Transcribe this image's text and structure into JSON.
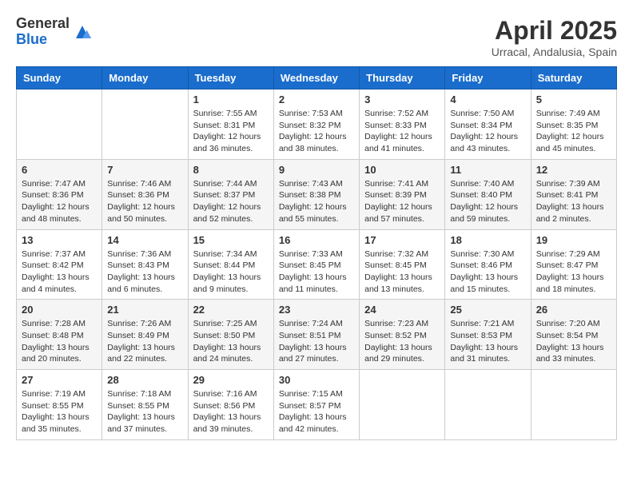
{
  "header": {
    "logo_general": "General",
    "logo_blue": "Blue",
    "month_title": "April 2025",
    "location": "Urracal, Andalusia, Spain"
  },
  "weekdays": [
    "Sunday",
    "Monday",
    "Tuesday",
    "Wednesday",
    "Thursday",
    "Friday",
    "Saturday"
  ],
  "weeks": [
    [
      {
        "day": "",
        "info": ""
      },
      {
        "day": "",
        "info": ""
      },
      {
        "day": "1",
        "info": "Sunrise: 7:55 AM\nSunset: 8:31 PM\nDaylight: 12 hours and 36 minutes."
      },
      {
        "day": "2",
        "info": "Sunrise: 7:53 AM\nSunset: 8:32 PM\nDaylight: 12 hours and 38 minutes."
      },
      {
        "day": "3",
        "info": "Sunrise: 7:52 AM\nSunset: 8:33 PM\nDaylight: 12 hours and 41 minutes."
      },
      {
        "day": "4",
        "info": "Sunrise: 7:50 AM\nSunset: 8:34 PM\nDaylight: 12 hours and 43 minutes."
      },
      {
        "day": "5",
        "info": "Sunrise: 7:49 AM\nSunset: 8:35 PM\nDaylight: 12 hours and 45 minutes."
      }
    ],
    [
      {
        "day": "6",
        "info": "Sunrise: 7:47 AM\nSunset: 8:36 PM\nDaylight: 12 hours and 48 minutes."
      },
      {
        "day": "7",
        "info": "Sunrise: 7:46 AM\nSunset: 8:36 PM\nDaylight: 12 hours and 50 minutes."
      },
      {
        "day": "8",
        "info": "Sunrise: 7:44 AM\nSunset: 8:37 PM\nDaylight: 12 hours and 52 minutes."
      },
      {
        "day": "9",
        "info": "Sunrise: 7:43 AM\nSunset: 8:38 PM\nDaylight: 12 hours and 55 minutes."
      },
      {
        "day": "10",
        "info": "Sunrise: 7:41 AM\nSunset: 8:39 PM\nDaylight: 12 hours and 57 minutes."
      },
      {
        "day": "11",
        "info": "Sunrise: 7:40 AM\nSunset: 8:40 PM\nDaylight: 12 hours and 59 minutes."
      },
      {
        "day": "12",
        "info": "Sunrise: 7:39 AM\nSunset: 8:41 PM\nDaylight: 13 hours and 2 minutes."
      }
    ],
    [
      {
        "day": "13",
        "info": "Sunrise: 7:37 AM\nSunset: 8:42 PM\nDaylight: 13 hours and 4 minutes."
      },
      {
        "day": "14",
        "info": "Sunrise: 7:36 AM\nSunset: 8:43 PM\nDaylight: 13 hours and 6 minutes."
      },
      {
        "day": "15",
        "info": "Sunrise: 7:34 AM\nSunset: 8:44 PM\nDaylight: 13 hours and 9 minutes."
      },
      {
        "day": "16",
        "info": "Sunrise: 7:33 AM\nSunset: 8:45 PM\nDaylight: 13 hours and 11 minutes."
      },
      {
        "day": "17",
        "info": "Sunrise: 7:32 AM\nSunset: 8:45 PM\nDaylight: 13 hours and 13 minutes."
      },
      {
        "day": "18",
        "info": "Sunrise: 7:30 AM\nSunset: 8:46 PM\nDaylight: 13 hours and 15 minutes."
      },
      {
        "day": "19",
        "info": "Sunrise: 7:29 AM\nSunset: 8:47 PM\nDaylight: 13 hours and 18 minutes."
      }
    ],
    [
      {
        "day": "20",
        "info": "Sunrise: 7:28 AM\nSunset: 8:48 PM\nDaylight: 13 hours and 20 minutes."
      },
      {
        "day": "21",
        "info": "Sunrise: 7:26 AM\nSunset: 8:49 PM\nDaylight: 13 hours and 22 minutes."
      },
      {
        "day": "22",
        "info": "Sunrise: 7:25 AM\nSunset: 8:50 PM\nDaylight: 13 hours and 24 minutes."
      },
      {
        "day": "23",
        "info": "Sunrise: 7:24 AM\nSunset: 8:51 PM\nDaylight: 13 hours and 27 minutes."
      },
      {
        "day": "24",
        "info": "Sunrise: 7:23 AM\nSunset: 8:52 PM\nDaylight: 13 hours and 29 minutes."
      },
      {
        "day": "25",
        "info": "Sunrise: 7:21 AM\nSunset: 8:53 PM\nDaylight: 13 hours and 31 minutes."
      },
      {
        "day": "26",
        "info": "Sunrise: 7:20 AM\nSunset: 8:54 PM\nDaylight: 13 hours and 33 minutes."
      }
    ],
    [
      {
        "day": "27",
        "info": "Sunrise: 7:19 AM\nSunset: 8:55 PM\nDaylight: 13 hours and 35 minutes."
      },
      {
        "day": "28",
        "info": "Sunrise: 7:18 AM\nSunset: 8:55 PM\nDaylight: 13 hours and 37 minutes."
      },
      {
        "day": "29",
        "info": "Sunrise: 7:16 AM\nSunset: 8:56 PM\nDaylight: 13 hours and 39 minutes."
      },
      {
        "day": "30",
        "info": "Sunrise: 7:15 AM\nSunset: 8:57 PM\nDaylight: 13 hours and 42 minutes."
      },
      {
        "day": "",
        "info": ""
      },
      {
        "day": "",
        "info": ""
      },
      {
        "day": "",
        "info": ""
      }
    ]
  ]
}
